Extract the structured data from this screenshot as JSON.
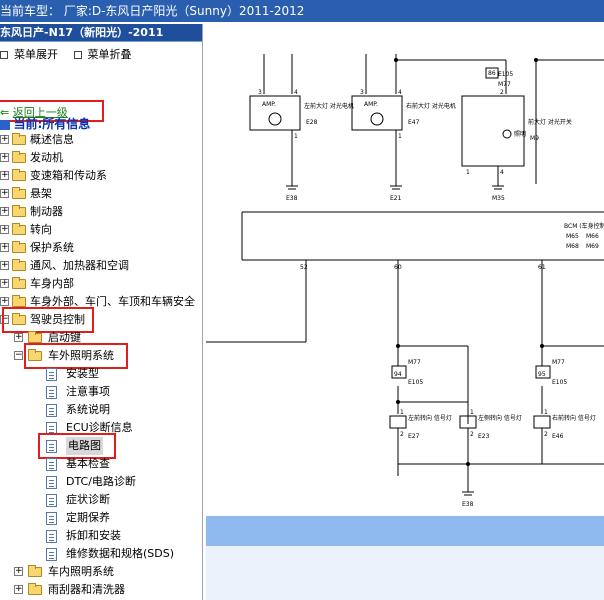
{
  "header": {
    "title": "当前车型：  厂家:D-东风日产阳光（Sunny）2011-2012"
  },
  "sidebar": {
    "title": "东风日产-N17（新阳光）-2011",
    "tools": {
      "expand": "菜单展开",
      "collapse": "菜单折叠"
    },
    "back": "返回上一级",
    "current": "当前:所有信息",
    "items": [
      {
        "label": "概述信息",
        "expander": "+"
      },
      {
        "label": "发动机",
        "expander": "+"
      },
      {
        "label": "变速箱和传动系",
        "expander": "+"
      },
      {
        "label": "悬架",
        "expander": "+"
      },
      {
        "label": "制动器",
        "expander": "+"
      },
      {
        "label": "转向",
        "expander": "+"
      },
      {
        "label": "保护系统",
        "expander": "+"
      },
      {
        "label": "通风、加热器和空调",
        "expander": "+"
      },
      {
        "label": "车身内部",
        "expander": "+"
      },
      {
        "label": "车身外部、车门、车顶和车辆安全",
        "expander": "+"
      },
      {
        "label": "驾驶员控制",
        "expander": "−"
      },
      {
        "label": "启动键",
        "expander": "+"
      },
      {
        "label": "车外照明系统",
        "expander": "−"
      },
      {
        "label": "安装型"
      },
      {
        "label": "注意事项"
      },
      {
        "label": "系统说明"
      },
      {
        "label": "ECU诊断信息"
      },
      {
        "label": "电路图"
      },
      {
        "label": "基本检查"
      },
      {
        "label": "DTC/电路诊断"
      },
      {
        "label": "症状诊断"
      },
      {
        "label": "定期保养"
      },
      {
        "label": "拆卸和安装"
      },
      {
        "label": "维修数据和规格(SDS)"
      },
      {
        "label": "车内照明系统",
        "expander": "+"
      },
      {
        "label": "雨刮器和清洗器",
        "expander": "+"
      }
    ]
  },
  "diagram": {
    "top_labels": {
      "amp1": "AMP.",
      "amp2": "AMP.",
      "left_motor": "左前大灯 对光电机",
      "right_motor": "右前大灯 对光电机",
      "e28": "E28",
      "e47": "E47",
      "e105": "E105",
      "m77": "M77",
      "n86": "86",
      "switch": "前大灯 对光开关",
      "m9": "M9",
      "lighting": "照明",
      "e38": "E38",
      "e21": "E21",
      "m35": "M35",
      "pin3a": "3",
      "pin4a": "4",
      "pin1a": "1",
      "pin3b": "3",
      "pin4b": "4",
      "pin1b": "1",
      "pin2": "2",
      "pin4c": "4",
      "pin1c": "1"
    },
    "bcm": {
      "label": "BCM (车身控制",
      "m65": "M65",
      "m66": "M66",
      "m68": "M68",
      "m69": "M69"
    },
    "wires": {
      "w52": "52",
      "w60": "60",
      "w61": "61"
    },
    "lower": {
      "m77a": "M77",
      "n94": "94",
      "e105a": "E105",
      "m77b": "M77",
      "n95": "95",
      "e105b": "E105",
      "lamp1": "左前转向 信号灯",
      "lamp2": "左侧转向 信号灯",
      "lamp3": "右前转向 信号灯",
      "e27": "E27",
      "e23": "E23",
      "e46": "E46",
      "e38b": "E38",
      "p1": "1",
      "p2": "2",
      "p3": "1",
      "p4": "2",
      "p5": "1",
      "p6": "2"
    }
  }
}
